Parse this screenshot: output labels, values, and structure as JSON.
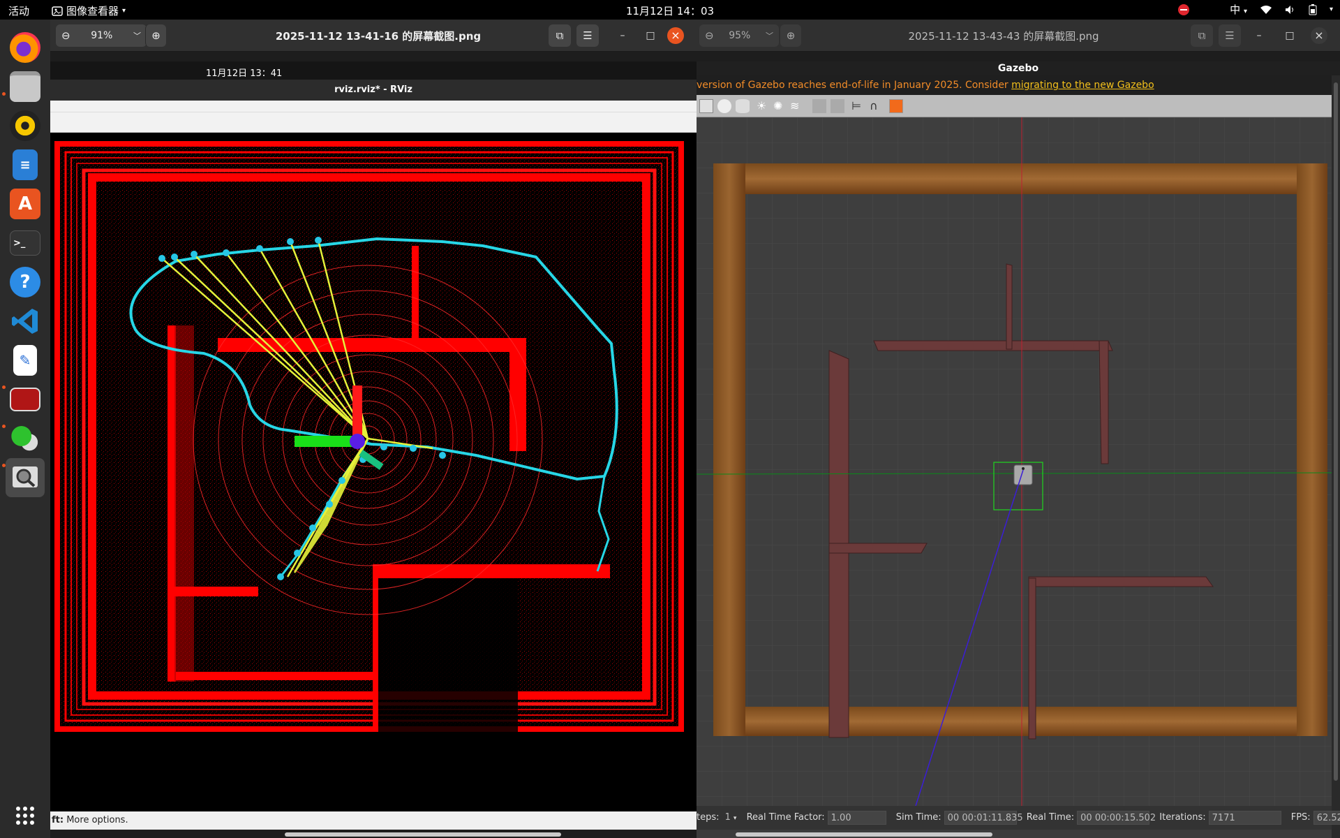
{
  "topbar": {
    "activities": "活动",
    "app_menu": "图像查看器",
    "clock": "11月12日  14：03",
    "input_method": "中"
  },
  "dock": {
    "items": [
      "firefox",
      "files",
      "rhythmbox",
      "libreoffice-writer",
      "app-center",
      "terminal",
      "help",
      "vscode",
      "text-editor",
      "rviz-app",
      "wechat",
      "image-viewer",
      "show-apps"
    ]
  },
  "left_window": {
    "zoom": "91%",
    "title": "2025-11-12 13-41-16 的屏幕截图.png",
    "shot": {
      "clock": "11月12日  13：41",
      "window_title": "rviz.rviz* - RViz",
      "status_prefix": "ft:",
      "status_text": " More options."
    }
  },
  "right_window": {
    "zoom": "95%",
    "title": "2025-11-12 13-43-43 的屏幕截图.png",
    "shot": {
      "window_title": "Gazebo",
      "banner_text": "version of Gazebo reaches end-of-life in January 2025. Consider ",
      "banner_link": "migrating to the new Gazebo",
      "steps_label": "teps:",
      "steps_value": "1",
      "rtf_label": "Real Time Factor:",
      "rtf_value": "1.00",
      "sim_label": "Sim Time:",
      "sim_value": "00 00:01:11.835",
      "real_label": "Real Time:",
      "real_value": "00 00:00:15.502",
      "iter_label": "Iterations:",
      "iter_value": "7171",
      "fps_label": "FPS:",
      "fps_value": "62.52"
    }
  },
  "colors": {
    "accent": "#e95420",
    "scan_red": "#ff0000",
    "path_cyan": "#27d6e6",
    "ray_yellow": "#e6f23a",
    "axis_green": "#19e019",
    "robot_blue": "#5a1ee6"
  }
}
